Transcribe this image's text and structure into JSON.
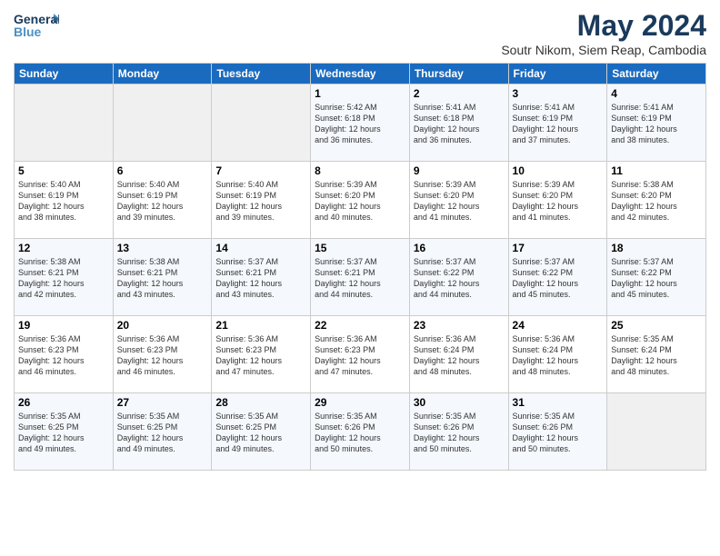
{
  "logo": {
    "line1": "General",
    "line2": "Blue"
  },
  "title": "May 2024",
  "location": "Soutr Nikom, Siem Reap, Cambodia",
  "days_header": [
    "Sunday",
    "Monday",
    "Tuesday",
    "Wednesday",
    "Thursday",
    "Friday",
    "Saturday"
  ],
  "weeks": [
    [
      {
        "day": "",
        "info": ""
      },
      {
        "day": "",
        "info": ""
      },
      {
        "day": "",
        "info": ""
      },
      {
        "day": "1",
        "info": "Sunrise: 5:42 AM\nSunset: 6:18 PM\nDaylight: 12 hours\nand 36 minutes."
      },
      {
        "day": "2",
        "info": "Sunrise: 5:41 AM\nSunset: 6:18 PM\nDaylight: 12 hours\nand 36 minutes."
      },
      {
        "day": "3",
        "info": "Sunrise: 5:41 AM\nSunset: 6:19 PM\nDaylight: 12 hours\nand 37 minutes."
      },
      {
        "day": "4",
        "info": "Sunrise: 5:41 AM\nSunset: 6:19 PM\nDaylight: 12 hours\nand 38 minutes."
      }
    ],
    [
      {
        "day": "5",
        "info": "Sunrise: 5:40 AM\nSunset: 6:19 PM\nDaylight: 12 hours\nand 38 minutes."
      },
      {
        "day": "6",
        "info": "Sunrise: 5:40 AM\nSunset: 6:19 PM\nDaylight: 12 hours\nand 39 minutes."
      },
      {
        "day": "7",
        "info": "Sunrise: 5:40 AM\nSunset: 6:19 PM\nDaylight: 12 hours\nand 39 minutes."
      },
      {
        "day": "8",
        "info": "Sunrise: 5:39 AM\nSunset: 6:20 PM\nDaylight: 12 hours\nand 40 minutes."
      },
      {
        "day": "9",
        "info": "Sunrise: 5:39 AM\nSunset: 6:20 PM\nDaylight: 12 hours\nand 41 minutes."
      },
      {
        "day": "10",
        "info": "Sunrise: 5:39 AM\nSunset: 6:20 PM\nDaylight: 12 hours\nand 41 minutes."
      },
      {
        "day": "11",
        "info": "Sunrise: 5:38 AM\nSunset: 6:20 PM\nDaylight: 12 hours\nand 42 minutes."
      }
    ],
    [
      {
        "day": "12",
        "info": "Sunrise: 5:38 AM\nSunset: 6:21 PM\nDaylight: 12 hours\nand 42 minutes."
      },
      {
        "day": "13",
        "info": "Sunrise: 5:38 AM\nSunset: 6:21 PM\nDaylight: 12 hours\nand 43 minutes."
      },
      {
        "day": "14",
        "info": "Sunrise: 5:37 AM\nSunset: 6:21 PM\nDaylight: 12 hours\nand 43 minutes."
      },
      {
        "day": "15",
        "info": "Sunrise: 5:37 AM\nSunset: 6:21 PM\nDaylight: 12 hours\nand 44 minutes."
      },
      {
        "day": "16",
        "info": "Sunrise: 5:37 AM\nSunset: 6:22 PM\nDaylight: 12 hours\nand 44 minutes."
      },
      {
        "day": "17",
        "info": "Sunrise: 5:37 AM\nSunset: 6:22 PM\nDaylight: 12 hours\nand 45 minutes."
      },
      {
        "day": "18",
        "info": "Sunrise: 5:37 AM\nSunset: 6:22 PM\nDaylight: 12 hours\nand 45 minutes."
      }
    ],
    [
      {
        "day": "19",
        "info": "Sunrise: 5:36 AM\nSunset: 6:23 PM\nDaylight: 12 hours\nand 46 minutes."
      },
      {
        "day": "20",
        "info": "Sunrise: 5:36 AM\nSunset: 6:23 PM\nDaylight: 12 hours\nand 46 minutes."
      },
      {
        "day": "21",
        "info": "Sunrise: 5:36 AM\nSunset: 6:23 PM\nDaylight: 12 hours\nand 47 minutes."
      },
      {
        "day": "22",
        "info": "Sunrise: 5:36 AM\nSunset: 6:23 PM\nDaylight: 12 hours\nand 47 minutes."
      },
      {
        "day": "23",
        "info": "Sunrise: 5:36 AM\nSunset: 6:24 PM\nDaylight: 12 hours\nand 48 minutes."
      },
      {
        "day": "24",
        "info": "Sunrise: 5:36 AM\nSunset: 6:24 PM\nDaylight: 12 hours\nand 48 minutes."
      },
      {
        "day": "25",
        "info": "Sunrise: 5:35 AM\nSunset: 6:24 PM\nDaylight: 12 hours\nand 48 minutes."
      }
    ],
    [
      {
        "day": "26",
        "info": "Sunrise: 5:35 AM\nSunset: 6:25 PM\nDaylight: 12 hours\nand 49 minutes."
      },
      {
        "day": "27",
        "info": "Sunrise: 5:35 AM\nSunset: 6:25 PM\nDaylight: 12 hours\nand 49 minutes."
      },
      {
        "day": "28",
        "info": "Sunrise: 5:35 AM\nSunset: 6:25 PM\nDaylight: 12 hours\nand 49 minutes."
      },
      {
        "day": "29",
        "info": "Sunrise: 5:35 AM\nSunset: 6:26 PM\nDaylight: 12 hours\nand 50 minutes."
      },
      {
        "day": "30",
        "info": "Sunrise: 5:35 AM\nSunset: 6:26 PM\nDaylight: 12 hours\nand 50 minutes."
      },
      {
        "day": "31",
        "info": "Sunrise: 5:35 AM\nSunset: 6:26 PM\nDaylight: 12 hours\nand 50 minutes."
      },
      {
        "day": "",
        "info": ""
      }
    ]
  ]
}
